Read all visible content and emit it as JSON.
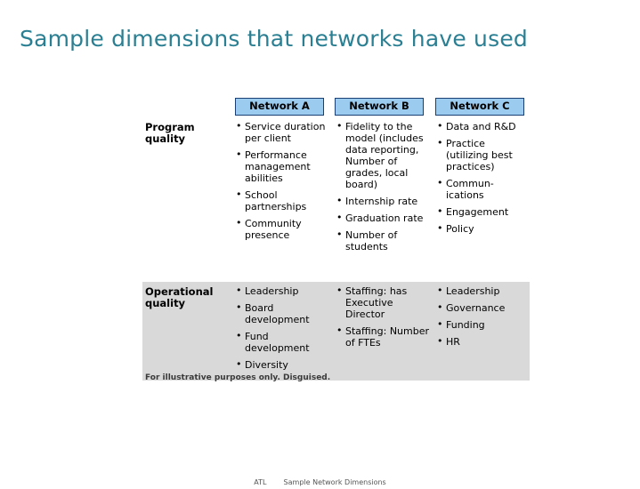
{
  "slide": {
    "title": "Sample dimensions that networks have used",
    "title_color": "#2b7f92",
    "background": "#ffffff"
  },
  "table": {
    "header_fill": "#9bcbee",
    "header_border": "#1a3f72",
    "band_fill": "#d9d9d9",
    "column_headers": [
      {
        "label": "Network A"
      },
      {
        "label": "Network B"
      },
      {
        "label": "Network C"
      }
    ],
    "rows": [
      {
        "label": "Program quality",
        "cells": [
          {
            "items": [
              "Service duration per client",
              "Performance management abilities",
              "School partnerships",
              "Community presence"
            ]
          },
          {
            "items": [
              "Fidelity to the model (includes data reporting, Number of grades, local board)",
              "Internship rate",
              "Graduation rate",
              "Number of students"
            ]
          },
          {
            "items": [
              "Data and R&D",
              "Practice (utilizing best practices)",
              "Commun-ications",
              "Engagement",
              "Policy"
            ]
          }
        ]
      },
      {
        "label": "Operational quality",
        "cells": [
          {
            "items": [
              "Leadership",
              "Board development",
              "Fund development",
              "Diversity"
            ]
          },
          {
            "items": [
              "Staffing: has Executive Director",
              "Staffing: Number of FTEs"
            ]
          },
          {
            "items": [
              "Leadership",
              "Governance",
              "Funding",
              "HR"
            ]
          }
        ]
      }
    ]
  },
  "footnote": "For illustrative purposes only.  Disguised.",
  "page_footer": {
    "left": "ATL",
    "right": "Sample Network Dimensions"
  }
}
